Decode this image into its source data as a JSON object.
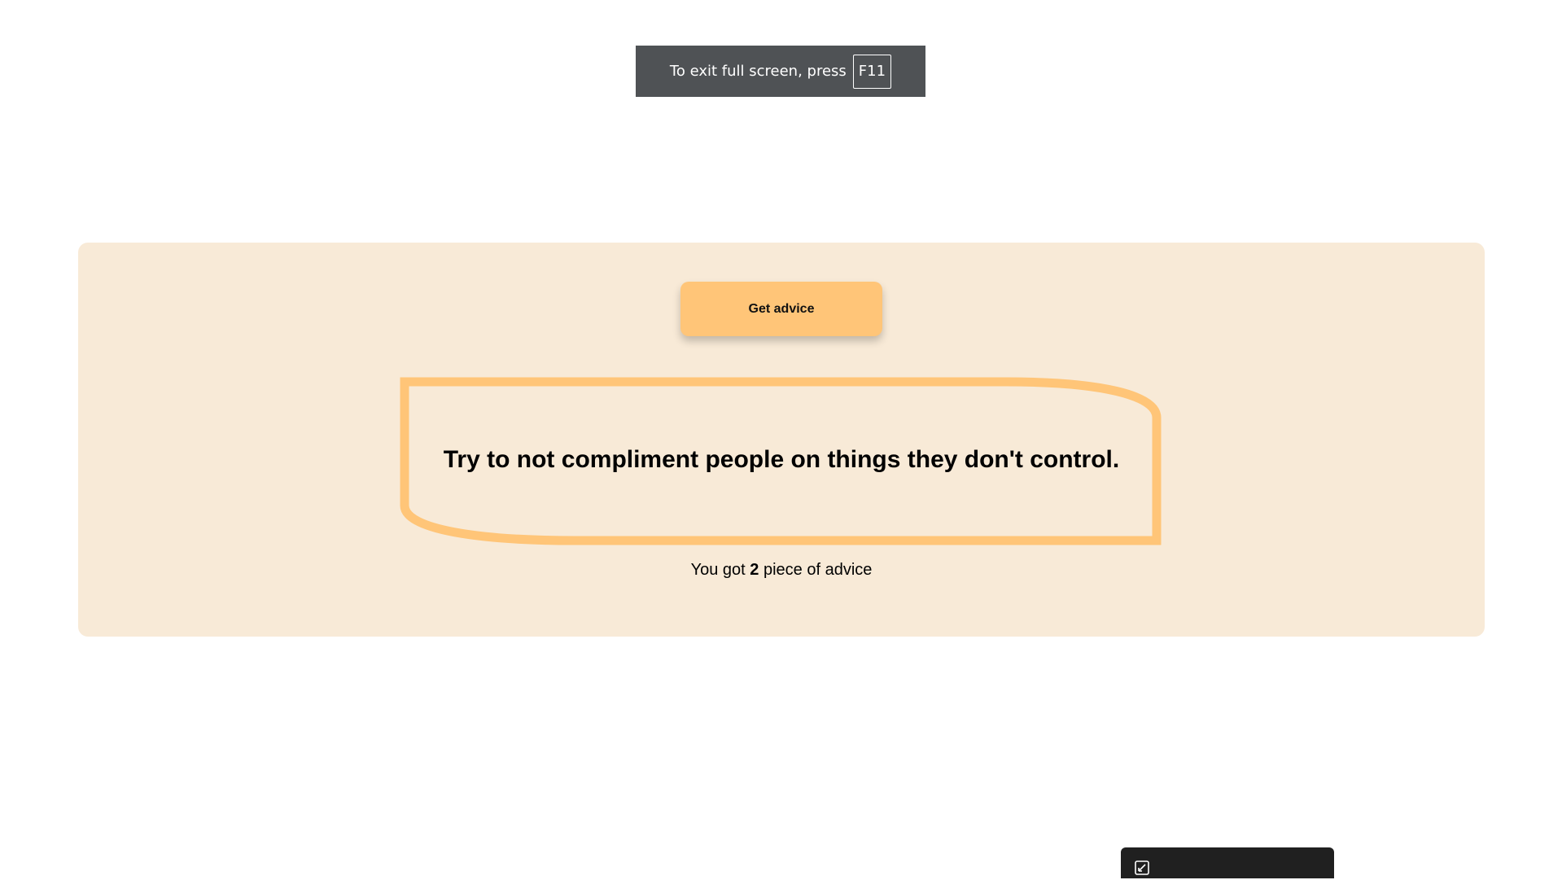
{
  "fullscreen_notice": {
    "text": "To exit full screen, press",
    "key": "F11"
  },
  "advice_app": {
    "button_label": "Get advice",
    "advice_text": "Try to not compliment people on things they don't control.",
    "count_prefix": "You got",
    "count_value": "2",
    "count_suffix": "piece of advice"
  },
  "bottom_toolbar": {
    "icon": "snip-expand-icon"
  },
  "colors": {
    "card_background": "#f8ead7",
    "accent": "#ffc578",
    "notice_background": "#4f5255",
    "toolbar_background": "#202020"
  }
}
